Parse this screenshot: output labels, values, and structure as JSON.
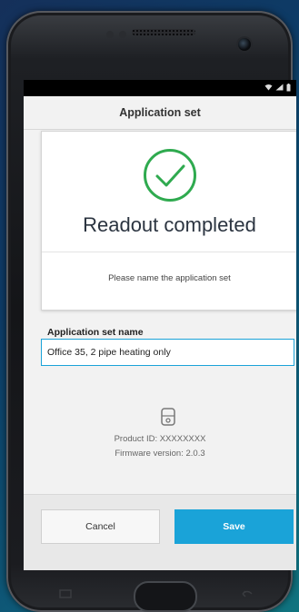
{
  "status_bar": {
    "signal_icon": "signal-icon",
    "wifi_icon": "wifi-icon",
    "battery_icon": "battery-icon"
  },
  "app_bar": {
    "title": "Application set"
  },
  "card": {
    "check_icon": "checkmark-circle-icon",
    "headline": "Readout completed",
    "prompt": "Please name the application set"
  },
  "form": {
    "label": "Application set name",
    "value": "Office 35, 2 pipe heating only"
  },
  "device": {
    "icon": "device-icon",
    "product_id": "Product ID:  XXXXXXXX",
    "firmware": "Firmware version: 2.0.3"
  },
  "actions": {
    "cancel": "Cancel",
    "save": "Save"
  },
  "colors": {
    "accent": "#1aa3d8",
    "success": "#2faa4f"
  }
}
